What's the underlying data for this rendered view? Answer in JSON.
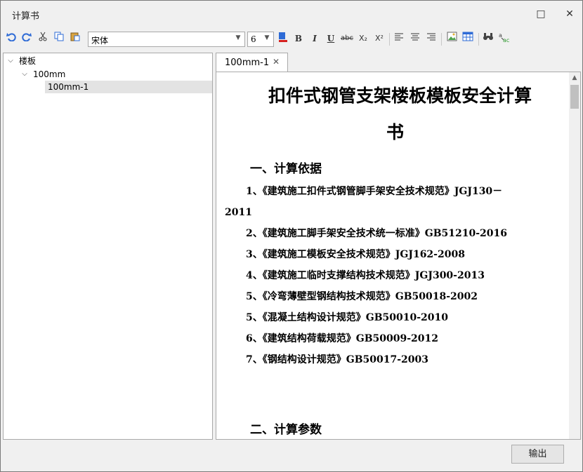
{
  "window": {
    "title": "计算书",
    "maximize_icon": "□",
    "close_icon": "✕"
  },
  "toolbar": {
    "font_name": "宋体",
    "font_size": "6",
    "bold_label": "B",
    "italic_label": "I",
    "underline_label": "U",
    "strike_label": "abc",
    "subscript_label": "X₂",
    "superscript_label": "X²",
    "icons": [
      "undo-icon",
      "redo-icon",
      "cut-icon",
      "copy-icon",
      "paste-icon",
      "font-color-icon",
      "align-left-icon",
      "align-center-icon",
      "align-right-icon",
      "insert-image-icon",
      "insert-table-icon",
      "find-icon",
      "replace-icon"
    ]
  },
  "tree": {
    "root": "楼板",
    "child": "100mm",
    "leaf": "100mm-1"
  },
  "tab": {
    "label": "100mm-1",
    "close": "✕"
  },
  "document": {
    "title_line1": "扣件式钢管支架楼板模板安全计算",
    "title_line2": "书",
    "section1": "一、计算依据",
    "refs": [
      {
        "num": "1、",
        "text": "《建筑施工扣件式钢管脚手架安全技术规范》JGJ130－"
      },
      {
        "num": "",
        "text": "2011"
      },
      {
        "num": "2、",
        "text": "《建筑施工脚手架安全技术统一标准》GB51210-2016"
      },
      {
        "num": "3、",
        "text": "《建筑施工模板安全技术规范》JGJ162-2008"
      },
      {
        "num": "4、",
        "text": "《建筑施工临时支撑结构技术规范》JGJ300-2013"
      },
      {
        "num": "5、",
        "text": "《冷弯薄壁型钢结构技术规范》GB50018-2002"
      },
      {
        "num": "5、",
        "text": "《混凝土结构设计规范》GB50010-2010"
      },
      {
        "num": "6、",
        "text": "《建筑结构荷载规范》GB50009-2012"
      },
      {
        "num": "7、",
        "text": "《钢结构设计规范》GB50017-2003"
      }
    ],
    "section2": "二、计算参数"
  },
  "footer": {
    "export_label": "输出"
  }
}
